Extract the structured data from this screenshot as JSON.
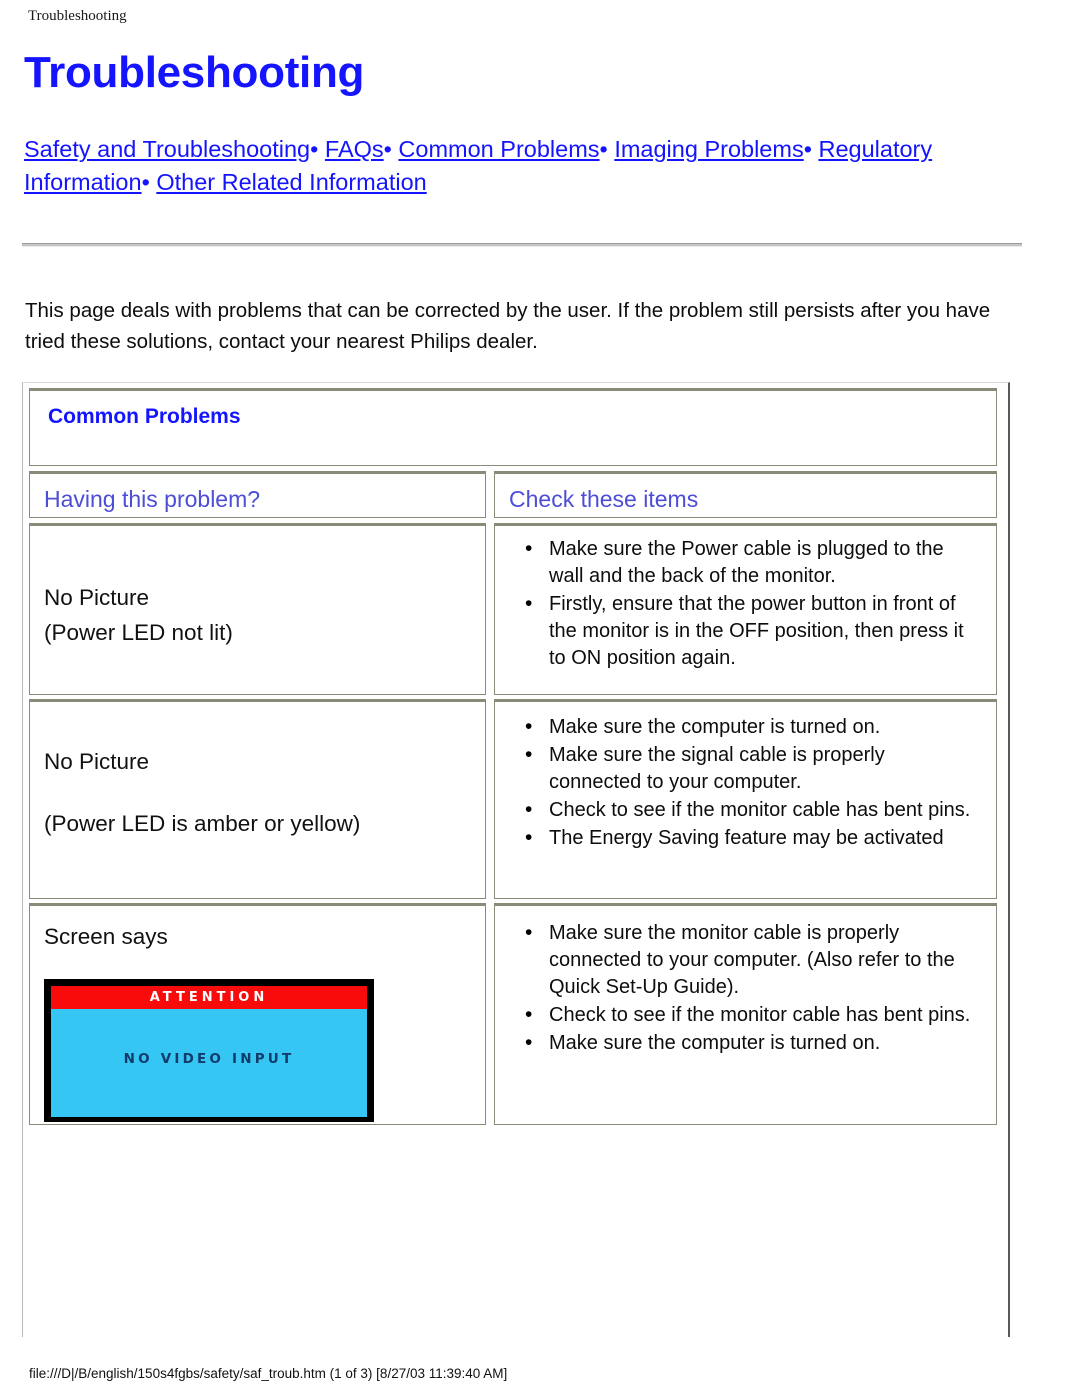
{
  "running_head": "Troubleshooting",
  "running_foot": "file:///D|/B/english/150s4fgbs/safety/saf_troub.htm (1 of 3) [8/27/03 11:39:40 AM]",
  "page": {
    "title": "Troubleshooting",
    "nav_links": [
      "Safety and Troubleshooting",
      "FAQs",
      "Common Problems",
      "Imaging Problems",
      "Regulatory Information",
      "Other Related Information"
    ],
    "nav_separator": "•",
    "intro": "This page deals with problems that can be corrected by the user. If the problem still persists after you have tried these solutions, contact your nearest Philips dealer."
  },
  "table": {
    "caption": "Common Problems",
    "headers": {
      "problem": "Having this problem?",
      "check": "Check these items"
    },
    "rows": [
      {
        "problem_line1": "No Picture",
        "problem_line2": "(Power LED not lit)",
        "checks": [
          "Make sure the Power cable is plugged to the wall and the back of the monitor.",
          "Firstly, ensure that the power button in front of the monitor is in the OFF position, then press it to ON position again."
        ]
      },
      {
        "problem_line1": "No Picture",
        "problem_line2": "(Power LED is amber or yellow)",
        "checks": [
          "Make sure the computer is turned on.",
          "Make sure the signal cable is properly connected to your computer.",
          "Check to see if the monitor cable has bent pins.",
          "The Energy Saving feature may be activated"
        ]
      },
      {
        "problem_line1": "Screen says",
        "problem_line2": "",
        "image": {
          "banner": "ATTENTION",
          "message": "NO VIDEO INPUT",
          "banner_color": "#f90b0b",
          "body_color": "#35c6f4",
          "message_color": "#123a6b"
        },
        "checks": [
          "Make sure the monitor cable is properly connected to your computer. (Also refer to the Quick Set-Up Guide).",
          "Check to see if the monitor cable has bent pins.",
          "Make sure the computer is turned on."
        ]
      }
    ]
  },
  "colors": {
    "link": "#1414ff",
    "heading": "#1414ff",
    "column_header": "#4d4dd6",
    "cell_border": "#8a8a78"
  }
}
